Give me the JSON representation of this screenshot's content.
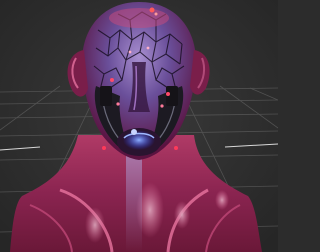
{
  "viewport": {
    "background_color": "#2e2e2e",
    "grid_color": "#5a5a5a",
    "grid_highlight_color": "#d0d0d0"
  },
  "model": {
    "icon": "sculpted-alien-head-render",
    "skin_base_color": "#8a1f47",
    "skin_highlight_color": "#e85a8a",
    "scalp_vein_color": "#1a1025",
    "scalp_base_color": "#6e5fa0",
    "mask_color": "#1c1a22",
    "mouth_glow_color": "#3a5cff"
  }
}
